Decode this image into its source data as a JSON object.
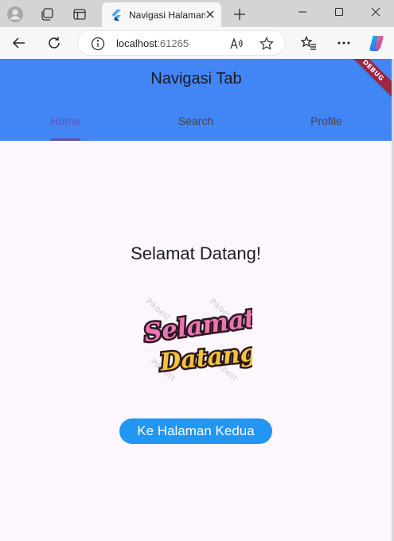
{
  "browser": {
    "tab_title": "Navigasi Halaman",
    "url_host": "localhost",
    "url_port": ":61265",
    "icons": {
      "profile": "profile-icon",
      "workspaces": "workspaces-icon",
      "tab_actions": "vertical-tabs-icon",
      "new_tab": "plus-icon",
      "minimize": "minimize-icon",
      "maximize": "maximize-icon",
      "close": "close-icon",
      "back": "back-arrow-icon",
      "refresh": "refresh-icon",
      "info": "info-icon",
      "read_aloud": "read-aloud-icon",
      "favorite": "star-icon",
      "favorites": "favorites-icon",
      "more": "more-icon",
      "copilot": "copilot-icon"
    }
  },
  "app": {
    "title": "Navigasi Tab",
    "tabs": [
      {
        "label": "Home",
        "active": true
      },
      {
        "label": "Search",
        "active": false
      },
      {
        "label": "Profile",
        "active": false
      }
    ],
    "debug_label": "DEBUG",
    "welcome_heading": "Selamat Datang!",
    "sticker": {
      "line1": "Selamat",
      "line2": "Datang",
      "watermark": "Pikbest"
    },
    "button_label": "Ke Halaman Kedua",
    "colors": {
      "appbar": "#4285f4",
      "background": "#fdf6fd",
      "indicator": "#6750a4",
      "button": "#2196f3",
      "debug": "#a0233f"
    }
  }
}
